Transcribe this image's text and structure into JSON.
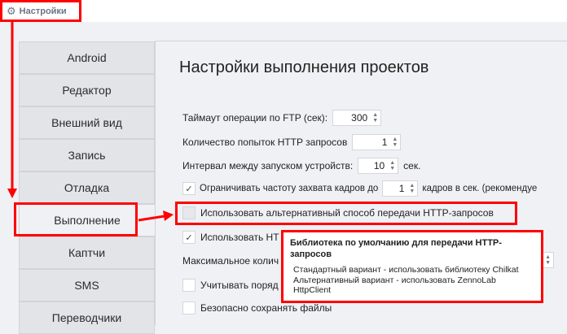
{
  "header": {
    "title": "Настройки",
    "icon": "gear-icon"
  },
  "sidebar": {
    "items": [
      {
        "label": "Android"
      },
      {
        "label": "Редактор"
      },
      {
        "label": "Внешний вид"
      },
      {
        "label": "Запись"
      },
      {
        "label": "Отладка"
      },
      {
        "label": "Выполнение",
        "selected": true
      },
      {
        "label": "Каптчи"
      },
      {
        "label": "SMS"
      },
      {
        "label": "Переводчики"
      }
    ]
  },
  "main": {
    "title": "Настройки выполнения проектов",
    "ftp_timeout": {
      "label": "Таймаут операции по FTP (сек):",
      "value": "300"
    },
    "http_attempts": {
      "label": "Количество попыток HTTP запросов",
      "value": "1"
    },
    "device_interval": {
      "label": "Интервал между запуском устройств:",
      "value": "10",
      "unit": "сек."
    },
    "limit_fps": {
      "label": "Ограничивать частоту захвата кадров до",
      "value": "1",
      "suffix": "кадров в сек. (рекомендуе",
      "checked": true
    },
    "alt_http": {
      "label": "Использовать альтернативный способ передачи HTTP-запросов",
      "checked": false
    },
    "use_ht": {
      "label": "Использовать НТ",
      "checked": true
    },
    "max_count": {
      "label": "Максимальное колич"
    },
    "consider_order": {
      "label": "Учитывать поряд",
      "checked": false
    },
    "safe_save": {
      "label": "Безопасно сохранять файлы",
      "checked": false
    }
  },
  "tooltip": {
    "title": "Библиотека по умолчанию для передачи HTTP-запросов",
    "lines": [
      "Стандартный вариант - использовать библиотеку Chilkat",
      "Альтернативный вариант - использовать ZennoLab HttpClient"
    ]
  },
  "colors": {
    "highlight": "#ff0000",
    "background": "#f0f1f5"
  }
}
